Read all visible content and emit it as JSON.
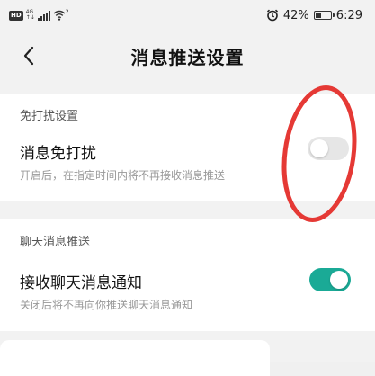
{
  "status_bar": {
    "hd": "HD",
    "network_top": "4G",
    "network_bottom": "↑↓",
    "wifi_label": "2",
    "battery_percent": "42%",
    "time": "6:29",
    "battery_level": 0.42
  },
  "header": {
    "title": "消息推送设置",
    "back_icon": "chevron-left-icon"
  },
  "dnd_section": {
    "header": "免打扰设置",
    "item_title": "消息免打扰",
    "item_subtitle": "开启后，在指定时间内将不再接收消息推送",
    "toggle_on": false
  },
  "chat_section": {
    "header": "聊天消息推送",
    "item_title": "接收聊天消息通知",
    "item_subtitle": "关闭后将不再向你推送聊天消息通知",
    "toggle_on": true
  },
  "colors": {
    "accent": "#1aaa96",
    "annotation": "#e53935",
    "toggle_off": "#e6e6e6"
  }
}
